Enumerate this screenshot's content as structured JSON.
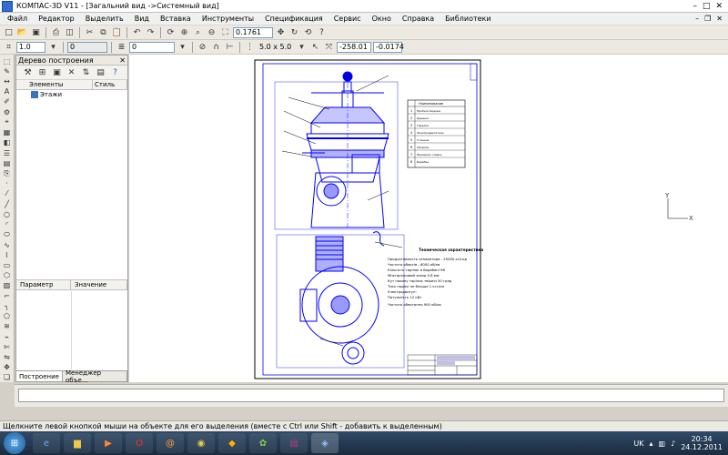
{
  "window": {
    "title": "КОМПАС-3D V11 - [Загальний вид ->Системный вид]"
  },
  "menu": [
    "Файл",
    "Редактор",
    "Выделить",
    "Вид",
    "Вставка",
    "Инструменты",
    "Спецификация",
    "Сервис",
    "Окно",
    "Справка",
    "Библиотеки"
  ],
  "toolbar": {
    "line_width": "1.0",
    "layer": "0",
    "style": "0",
    "grid": "5.0 x 5.0",
    "zoom": "0.1761",
    "coord_x": "-258.01",
    "coord_y": "-0.0174"
  },
  "tree_panel": {
    "title": "Дерево построения",
    "col_elements": "Элементы",
    "col_style": "Стиль",
    "root_item": "Этажи",
    "param_label": "Параметр",
    "value_label": "Значение",
    "tab_build": "Построение",
    "tab_manager": "Менеджер объе..."
  },
  "drawing": {
    "spec_title": "Наименование",
    "spec_rows": [
      {
        "pos": "1",
        "name": "Пробкоотводчик"
      },
      {
        "pos": "2",
        "name": "Крышка"
      },
      {
        "pos": "3",
        "name": "Тарелки"
      },
      {
        "pos": "4",
        "name": "Электродвигатель"
      },
      {
        "pos": "5",
        "name": "Станина"
      },
      {
        "pos": "6",
        "name": "Сборник"
      },
      {
        "pos": "7",
        "name": "Приемник сливок"
      },
      {
        "pos": "8",
        "name": "Барабан"
      }
    ],
    "tech_title": "Техническая характеристика",
    "tech_lines": [
      "Продуктивность сепаратора - 25000 кг/год",
      "Частота обертів - 6000 об/хв",
      "Кількість тарілок в барабані 96",
      "Міжтарілковий зазор 0,8 мм",
      "Кут нахилу тарілок твірної 50 град",
      "Тиск подачі не більше 1 кгс/см",
      "Електродвигун:",
      "Потужність 12 кВт",
      "Частота обертання 900 об/хв"
    ],
    "axis_y": "Y",
    "axis_x": "X"
  },
  "status": {
    "message": "Щелкните левой кнопкой мыши на объекте для его выделения (вместе с Ctrl или Shift - добавить к выделенным)"
  },
  "taskbar": {
    "lang": "UK",
    "time": "20:34",
    "date": "24.12.2011"
  }
}
